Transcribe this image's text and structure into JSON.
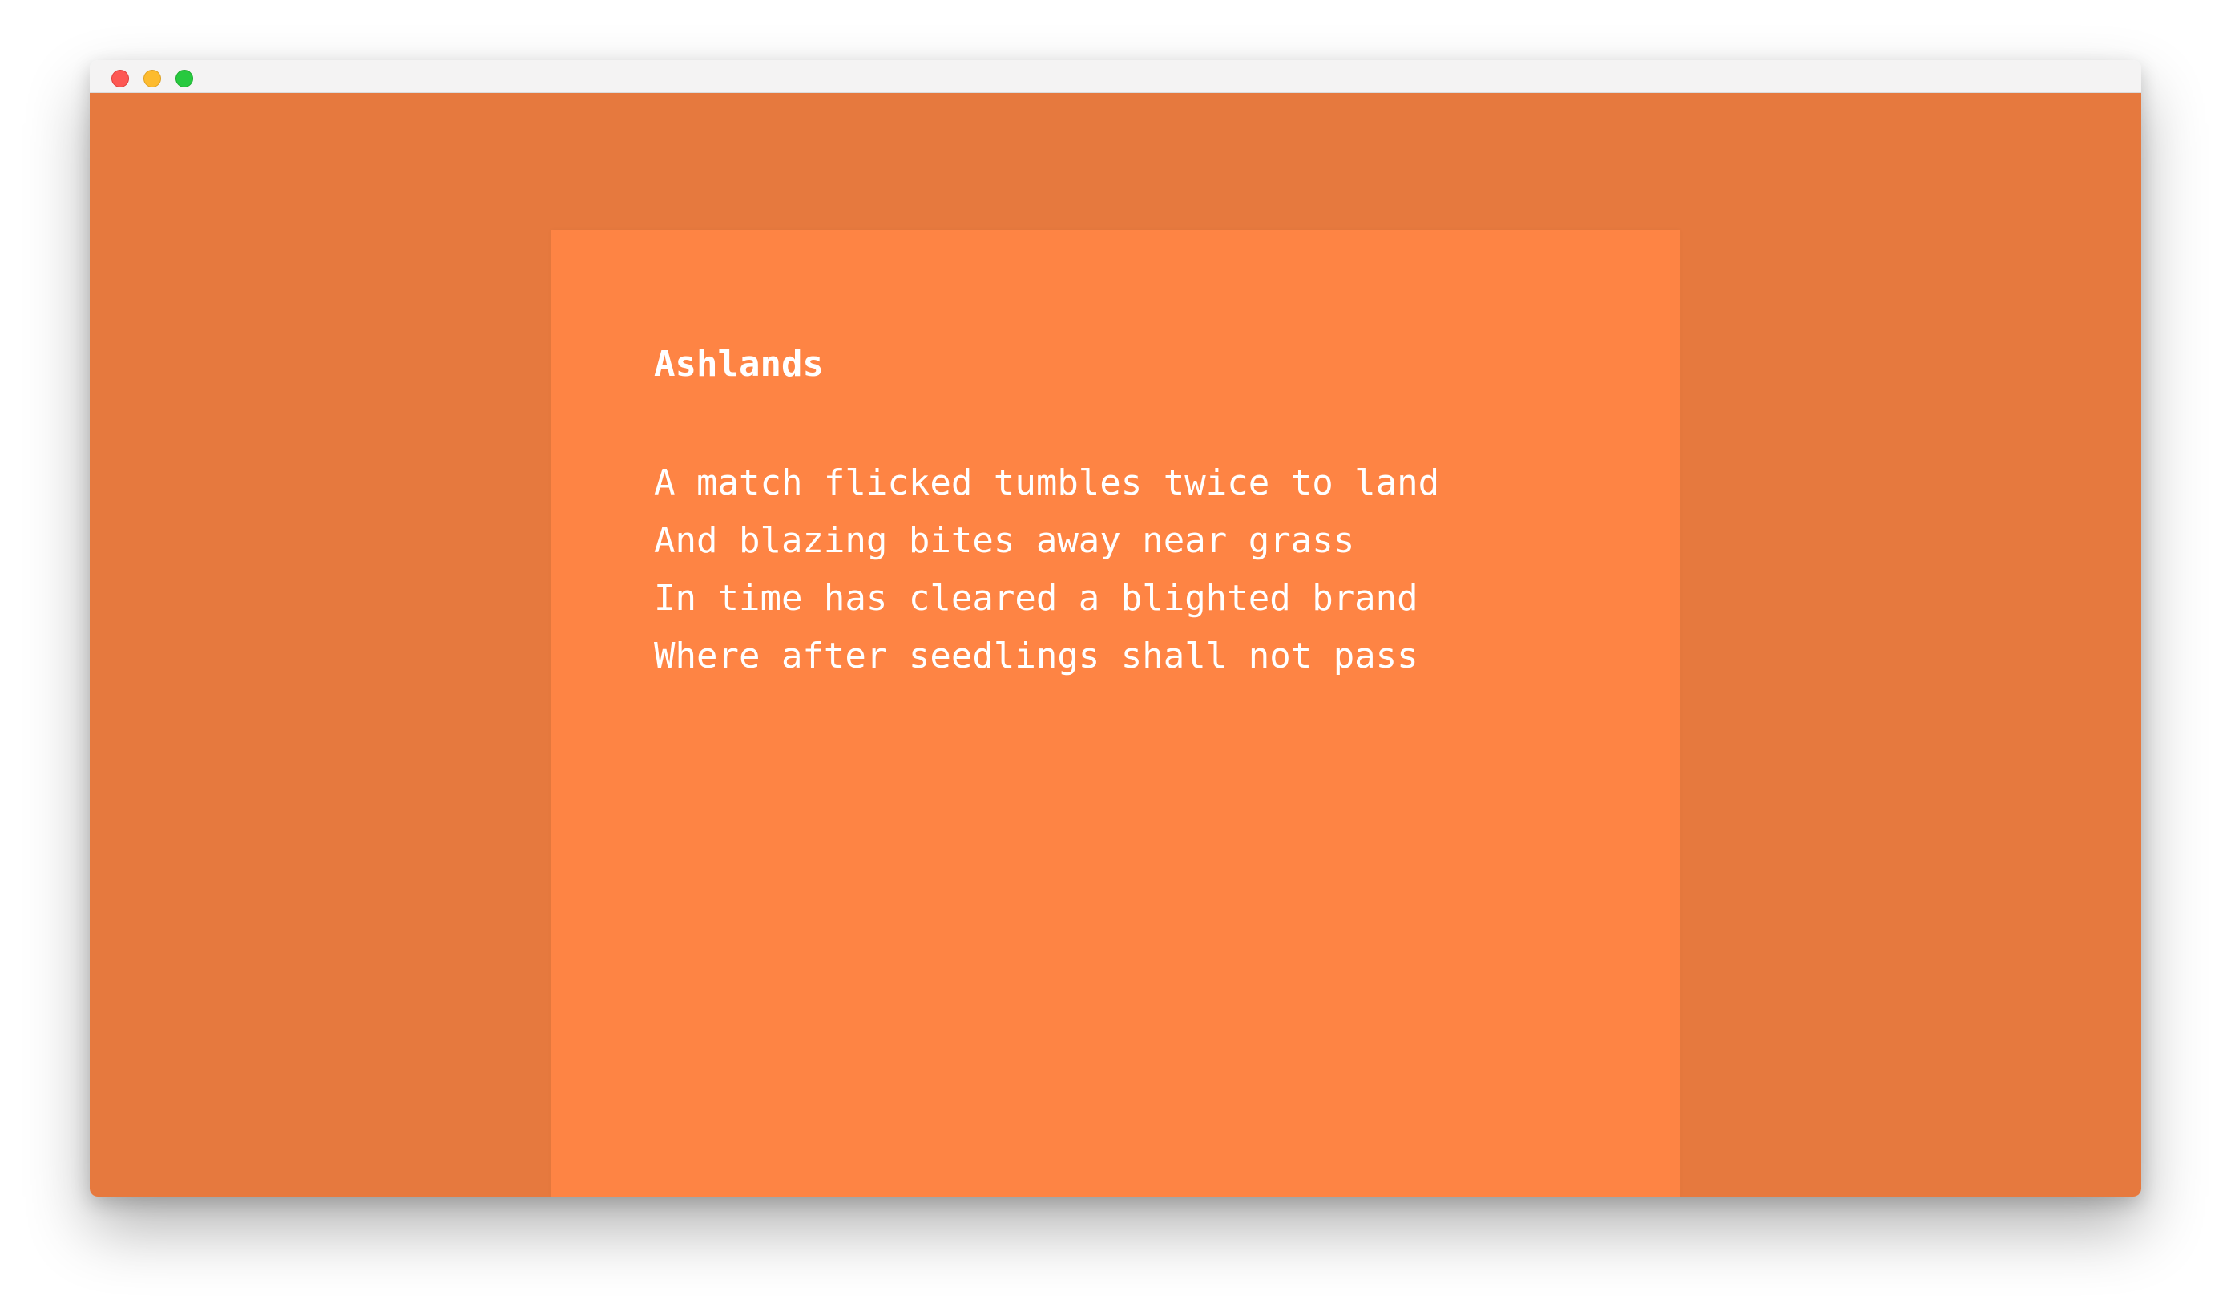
{
  "window": {
    "controls": [
      {
        "name": "close",
        "color": "#fd5853"
      },
      {
        "name": "minimize",
        "color": "#fdbb2e"
      },
      {
        "name": "maximize",
        "color": "#27c93f"
      }
    ]
  },
  "colors": {
    "background": "#e6793e",
    "card": "#fe8444",
    "text": "#ffffff"
  },
  "poem": {
    "title": "Ashlands",
    "lines": [
      "A match flicked tumbles twice to land",
      "And blazing bites away near grass",
      "In time has cleared a blighted brand",
      "Where after seedlings shall not pass"
    ]
  }
}
